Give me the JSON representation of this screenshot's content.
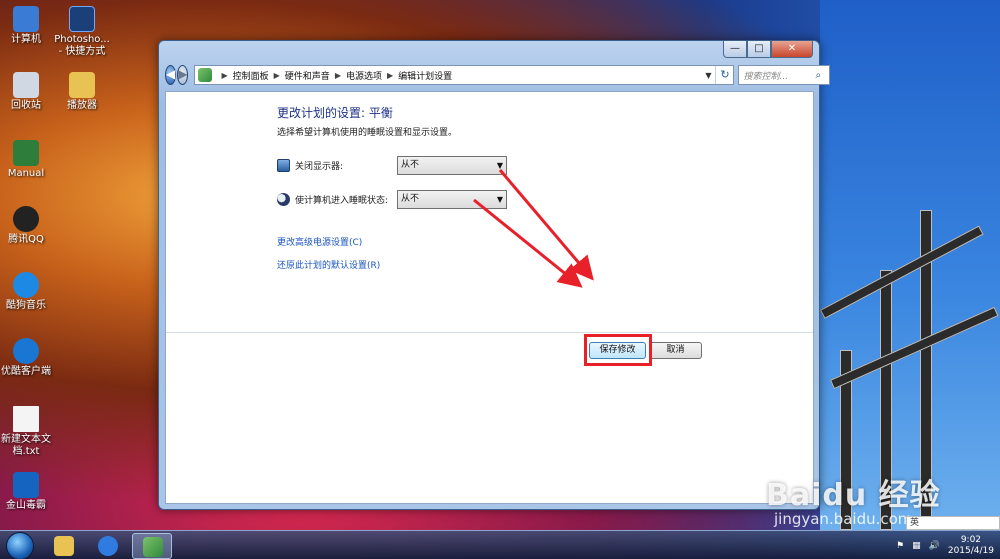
{
  "desktop": {
    "icons": [
      {
        "label": "计算机",
        "icon": "computer-icon",
        "color": "#3a7bd5"
      },
      {
        "label": "Photosho... - 快捷方式",
        "icon": "photoshop-icon",
        "color": "#1b3f78"
      },
      {
        "label": "回收站",
        "icon": "recycle-bin-icon",
        "color": "#cfd8e3"
      },
      {
        "label": "播放器",
        "icon": "folder-icon",
        "color": "#e8c252"
      },
      {
        "label": "Manual",
        "icon": "shortcut-icon",
        "color": "#2e7d3b"
      },
      {
        "label": "腾讯QQ",
        "icon": "qq-icon",
        "color": "#222222"
      },
      {
        "label": "酷狗音乐",
        "icon": "kugou-icon",
        "color": "#1e88e5"
      },
      {
        "label": "优酷客户端",
        "icon": "youku-icon",
        "color": "#1976d2"
      },
      {
        "label": "新建文本文档.txt",
        "icon": "text-file-icon",
        "color": "#f4f4f4"
      },
      {
        "label": "金山毒霸",
        "icon": "antivirus-icon",
        "color": "#1565c0"
      }
    ]
  },
  "window": {
    "controls": {
      "minimize": "—",
      "maximize": "□",
      "close": "✕"
    },
    "breadcrumbs": [
      "控制面板",
      "硬件和声音",
      "电源选项",
      "编辑计划设置"
    ],
    "search_placeholder": "搜索控制...",
    "title": "更改计划的设置: 平衡",
    "subtitle": "选择希望计算机使用的睡眠设置和显示设置。",
    "settings": [
      {
        "label": "关闭显示器:",
        "value": "从不",
        "icon": "monitor-icon"
      },
      {
        "label": "使计算机进入睡眠状态:",
        "value": "从不",
        "icon": "moon-icon"
      }
    ],
    "links": {
      "advanced": "更改高级电源设置(C)",
      "restore": "还原此计划的默认设置(R)"
    },
    "buttons": {
      "save": "保存修改",
      "cancel": "取消"
    },
    "highlight_color": "#e8202a"
  },
  "taskbar": {
    "time": "9:02",
    "date": "2015/4/19",
    "ime_text": "英"
  },
  "watermark": {
    "logo": "Baidu 经验",
    "url": "jingyan.baidu.com"
  }
}
